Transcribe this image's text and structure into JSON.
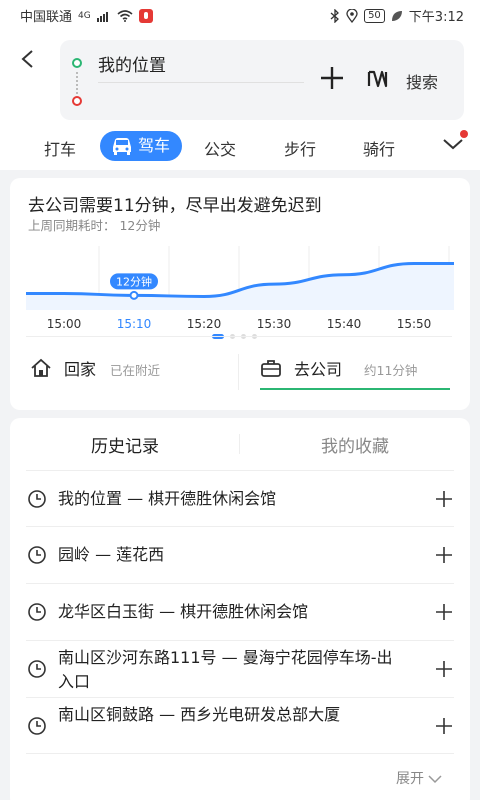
{
  "status_bar": {
    "carrier": "中国联通",
    "network": "4G",
    "battery": "50",
    "time": "下午3:12",
    "colors": {
      "mic_badge": "#e53935"
    }
  },
  "route": {
    "from": "我的位置",
    "to": "",
    "search_label": "搜索"
  },
  "modes": [
    {
      "label": "打车",
      "active": false
    },
    {
      "label": "驾车",
      "active": true
    },
    {
      "label": "公交",
      "active": false
    },
    {
      "label": "步行",
      "active": false
    },
    {
      "label": "骑行",
      "active": false
    }
  ],
  "commute": {
    "title": "去公司需要11分钟，尽早出发避免迟到",
    "subtitle": "上周同期耗时： 12分钟",
    "highlight_label": "12分钟",
    "pager": {
      "pages": 4,
      "current": 1
    },
    "home": {
      "label": "回家",
      "note": "已在附近"
    },
    "work": {
      "label": "去公司",
      "note": "约11分钟"
    }
  },
  "chart_data": {
    "type": "line",
    "x": [
      "15:00",
      "15:10",
      "15:20",
      "15:30",
      "15:40",
      "15:50"
    ],
    "series": [
      {
        "values": [
          10,
          9.5,
          9.2,
          12.5,
          15,
          18
        ]
      }
    ],
    "highlight": {
      "x": "15:10",
      "label": "12分钟"
    },
    "xlabel": "",
    "ylabel": "",
    "colors": {
      "line": "#3388ff",
      "fill": "#eef5ff"
    }
  },
  "history": {
    "tabs": [
      "历史记录",
      "我的收藏"
    ],
    "active_tab": 0,
    "items": [
      {
        "text": "我的位置 — 棋开德胜休闲会馆"
      },
      {
        "text": "园岭 — 莲花西"
      },
      {
        "text": "龙华区白玉街 — 棋开德胜休闲会馆"
      },
      {
        "text": "南山区沙河东路111号 — 曼海宁花园停车场-出入口"
      },
      {
        "text": "南山区铜鼓路 — 西乡光电研发总部大厦"
      }
    ],
    "expand_label": "展开"
  },
  "colors": {
    "accent": "#3388ff",
    "start_dot": "#2bb673",
    "end_dot": "#e53935",
    "work_underline": "#2bb673"
  }
}
